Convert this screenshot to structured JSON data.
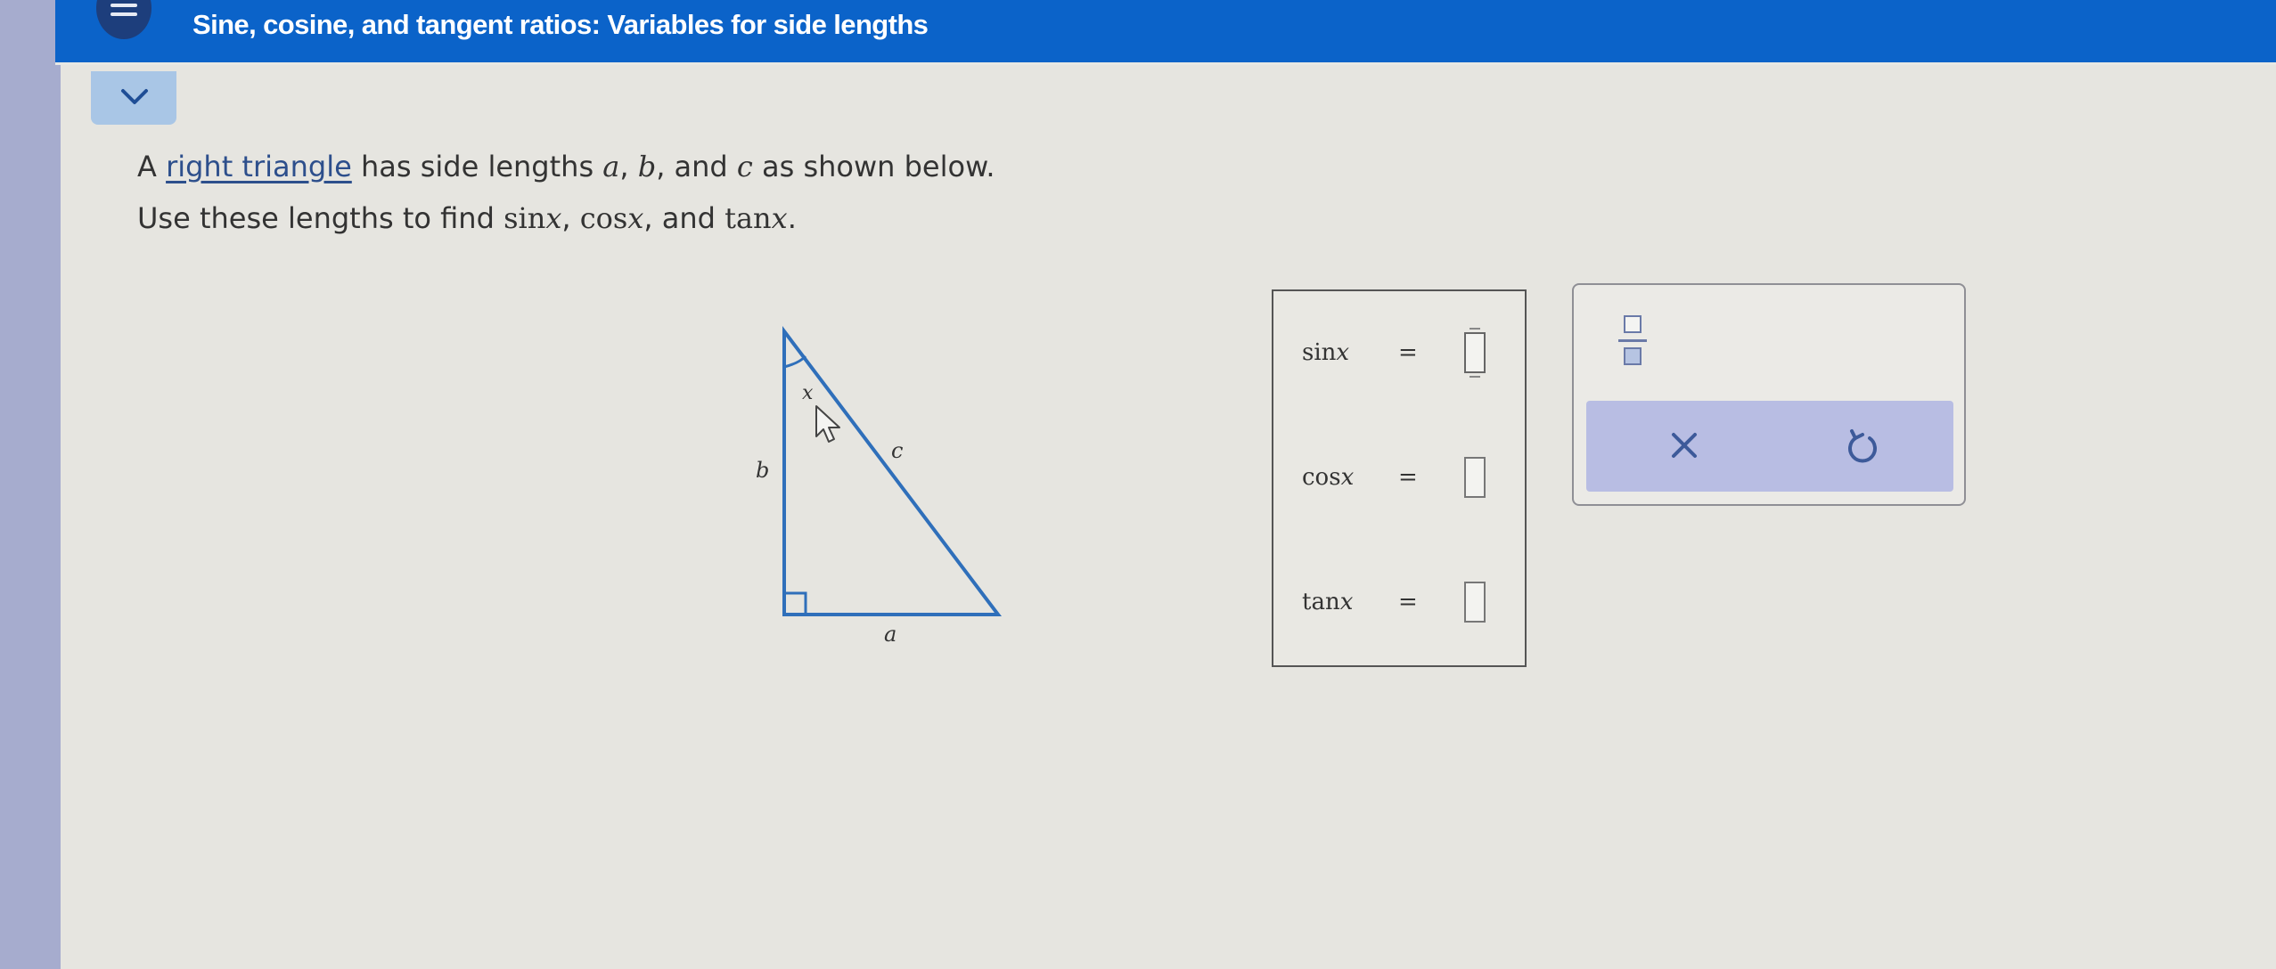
{
  "header": {
    "title": "Sine, cosine, and tangent ratios: Variables for side lengths"
  },
  "problem": {
    "line1_prefix": "A ",
    "link_text": "right triangle",
    "line1_mid": " has side lengths ",
    "var_a": "a",
    "sep1": ", ",
    "var_b": "b",
    "sep2": ", and ",
    "var_c": "c",
    "line1_suffix": " as shown below.",
    "line2_prefix": "Use these lengths to find ",
    "sin_expr": "sin",
    "cos_expr": "cos",
    "tan_expr": "tan",
    "var_x": "x",
    "sep3": ", ",
    "sep4": ", and ",
    "end": "."
  },
  "triangle": {
    "angle_label": "x",
    "side_b": "b",
    "side_c": "c",
    "side_a": "a",
    "stroke_color": "#2f6fba"
  },
  "answers": {
    "rows": [
      {
        "fn": "sin",
        "var": "x",
        "equals": "=",
        "value": ""
      },
      {
        "fn": "cos",
        "var": "x",
        "equals": "=",
        "value": ""
      },
      {
        "fn": "tan",
        "var": "x",
        "equals": "=",
        "value": ""
      }
    ]
  },
  "toolbar": {
    "fraction_icon": "fraction-icon",
    "clear_icon": "x-icon",
    "undo_icon": "undo-icon",
    "clear_glyph": "×"
  },
  "colors": {
    "header_bg": "#0b63c9",
    "accent": "#2f6fba",
    "action_bar": "#b8bde3"
  }
}
